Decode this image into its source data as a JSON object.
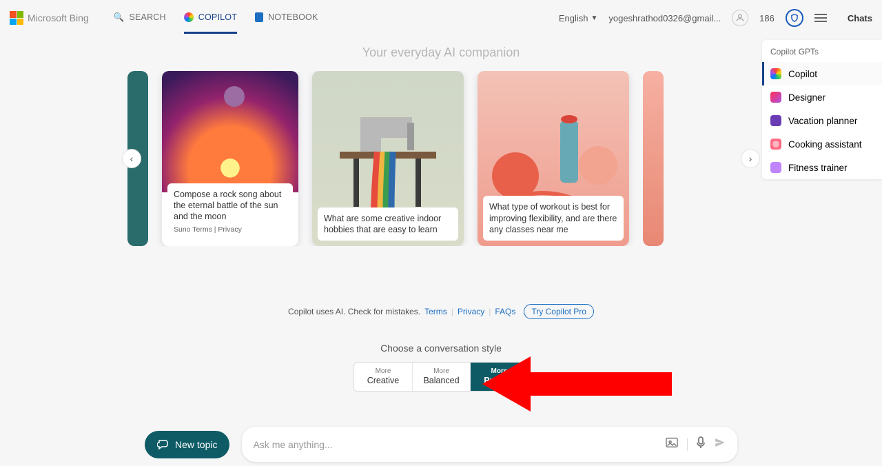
{
  "header": {
    "brand": "Microsoft Bing",
    "nav": {
      "search": "SEARCH",
      "copilot": "COPILOT",
      "notebook": "NOTEBOOK"
    },
    "language": "English",
    "email": "yogeshrathod0326@gmail...",
    "points": "186",
    "chats_label": "Chats"
  },
  "right_panel": {
    "title": "Copilot GPTs",
    "items": [
      "Copilot",
      "Designer",
      "Vacation planner",
      "Cooking assistant",
      "Fitness trainer"
    ]
  },
  "main": {
    "tagline": "Your everyday AI companion",
    "cards": [
      {
        "caption": "Compose a rock song about the eternal battle of the sun and the moon",
        "links": "Suno Terms | Privacy"
      },
      {
        "caption": "What are some creative indoor hobbies that are easy to learn"
      },
      {
        "caption": "What type of workout is best for improving flexibility, and are there any classes near me"
      }
    ],
    "disclaimer": "Copilot uses AI. Check for mistakes.",
    "links": {
      "terms": "Terms",
      "privacy": "Privacy",
      "faqs": "FAQs",
      "try": "Try Copilot Pro"
    },
    "style_title": "Choose a conversation style",
    "styles": [
      {
        "top": "More",
        "bottom": "Creative"
      },
      {
        "top": "More",
        "bottom": "Balanced"
      },
      {
        "top": "More",
        "bottom": "Precise"
      }
    ],
    "selected_style_index": 2
  },
  "bottom": {
    "new_topic": "New topic",
    "placeholder": "Ask me anything..."
  }
}
